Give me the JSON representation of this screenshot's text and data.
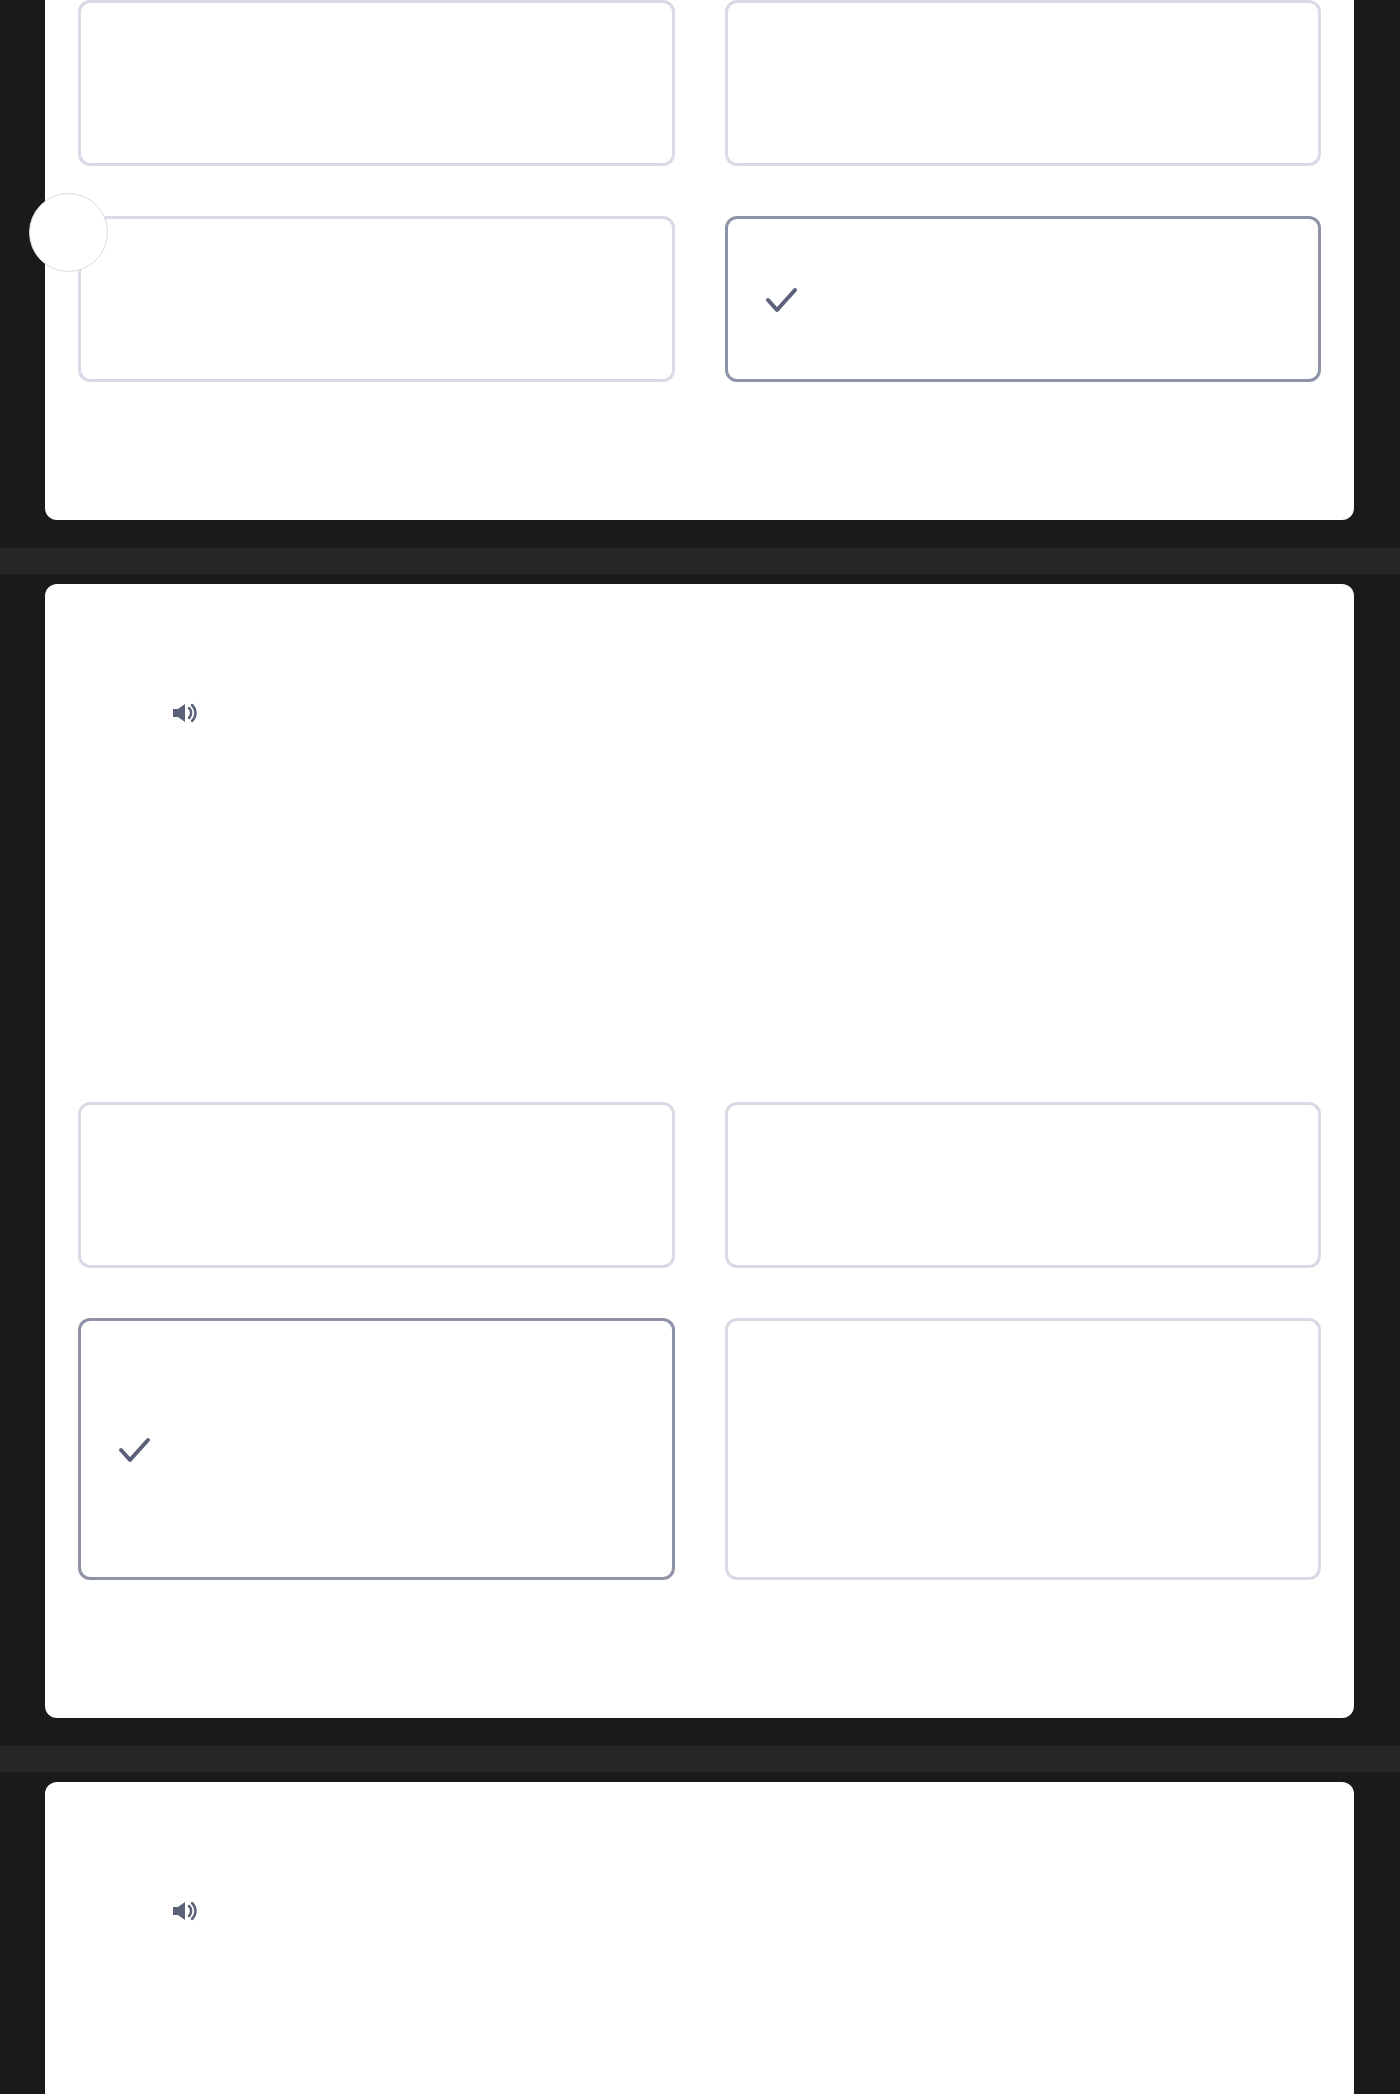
{
  "questions": [
    {
      "kind": "cut",
      "options": [
        {
          "selected": false
        },
        {
          "selected": false
        },
        {
          "selected": false
        },
        {
          "selected": true
        }
      ]
    },
    {
      "kind": "audio",
      "options": [
        {
          "selected": false
        },
        {
          "selected": false
        },
        {
          "selected": true
        },
        {
          "selected": false
        }
      ]
    },
    {
      "kind": "audio"
    }
  ]
}
